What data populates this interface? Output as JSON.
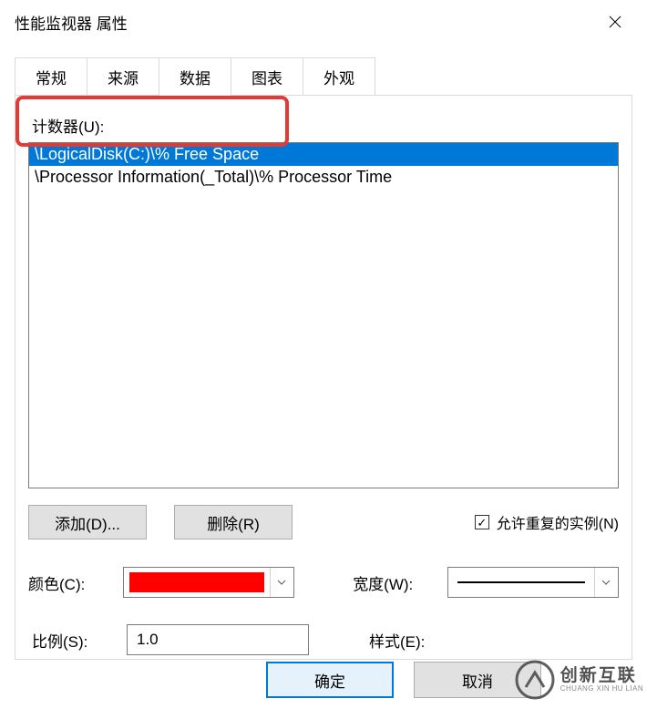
{
  "title": "性能监视器 属性",
  "tabs": [
    "常规",
    "来源",
    "数据",
    "图表",
    "外观"
  ],
  "active_tab": 2,
  "counters": {
    "label": "计数器(U):",
    "items": [
      "\\LogicalDisk(C:)\\% Free Space",
      "\\Processor Information(_Total)\\% Processor Time"
    ],
    "selected_index": 0
  },
  "buttons": {
    "add": "添加(D)...",
    "remove": "删除(R)"
  },
  "allow_dup": {
    "label": "允许重复的实例(N)",
    "checked": true
  },
  "color": {
    "label": "颜色(C):",
    "value": "#ff0000"
  },
  "width": {
    "label": "宽度(W):"
  },
  "scale": {
    "label": "比例(S):",
    "value": "1.0"
  },
  "style": {
    "label": "样式(E):"
  },
  "footer": {
    "ok": "确定",
    "cancel": "取消"
  },
  "watermark": {
    "cn": "创新互联",
    "en": "CHUANG XIN HU LIAN"
  }
}
